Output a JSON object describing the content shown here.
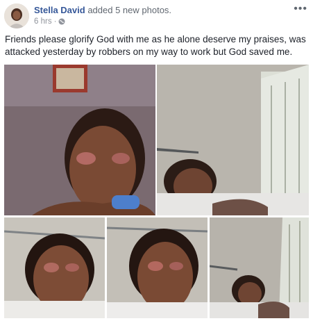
{
  "post": {
    "author": "Stella David",
    "action": "added 5 new photos.",
    "time": "6 hrs",
    "separator": "·",
    "privacy_icon": "globe-icon",
    "more_icon": "more-options-icon",
    "more_glyph": "•••",
    "text": "Friends please glorify God with me as he alone deserve my praises, was attacked yesterday by robbers on my way to work but God saved me."
  },
  "photos": [
    {
      "name": "photo-1",
      "alt_icon": "injured-woman-closeup-photo"
    },
    {
      "name": "photo-2",
      "alt_icon": "woman-lying-on-bed-photo"
    },
    {
      "name": "photo-3",
      "alt_icon": "injured-woman-closeup-photo"
    },
    {
      "name": "photo-4",
      "alt_icon": "injured-woman-closeup-photo"
    },
    {
      "name": "photo-5",
      "alt_icon": "woman-lying-on-bed-photo"
    }
  ],
  "colors": {
    "link": "#365899",
    "meta": "#90949c",
    "text": "#1d2129"
  }
}
